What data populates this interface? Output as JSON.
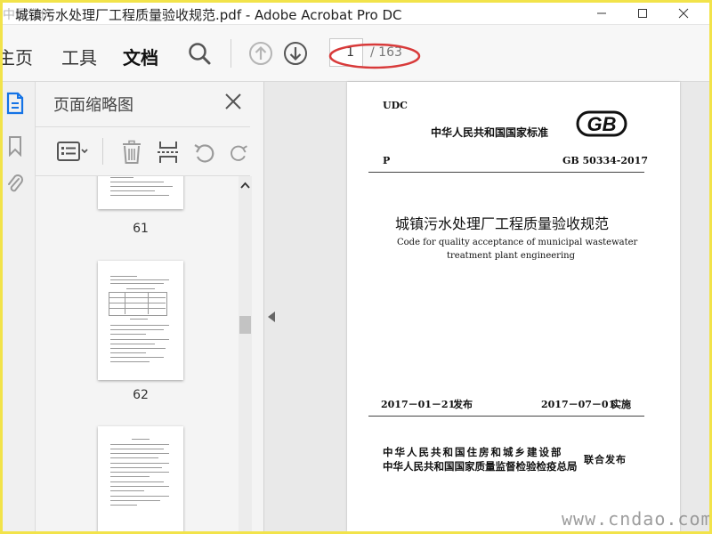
{
  "window": {
    "title": "城镇污水处理厂工程质量验收规范.pdf - Adobe Acrobat Pro DC",
    "watermark_top_left": "中国造价"
  },
  "menu": {
    "tabs": [
      {
        "label": "主页",
        "active": false
      },
      {
        "label": "工具",
        "active": false
      },
      {
        "label": "文档",
        "active": true
      }
    ]
  },
  "toolbar": {
    "current_page": "1",
    "total_pages": "/ 163",
    "annotation_color": "#d83a3a"
  },
  "thumbnails_panel": {
    "title": "页面缩略图",
    "pages": [
      {
        "number": "61"
      },
      {
        "number": "62"
      },
      {
        "number": ""
      }
    ]
  },
  "document": {
    "udc": "UDC",
    "issuer_line": "中华人民共和国国家标准",
    "logo_text": "GB",
    "category": "P",
    "std_number": "GB 50334-2017",
    "title_cn": "城镇污水处理厂工程质量验收规范",
    "title_en_line1": "Code for quality acceptance of municipal wastewater",
    "title_en_line2": "treatment plant engineering",
    "issue_date": "2017－01－21",
    "issue_label": "发布",
    "effective_date": "2017－07－01",
    "effective_label": "实施",
    "publisher1": "中华人民共和国住房和城乡建设部",
    "publisher2": "中华人民共和国国家质量监督检验检疫总局",
    "joint_label": "联合发布"
  },
  "watermark_bottom_right": "www.cndao.com",
  "colors": {
    "accent": "#1473e6",
    "frame_border": "#f2e34a"
  }
}
